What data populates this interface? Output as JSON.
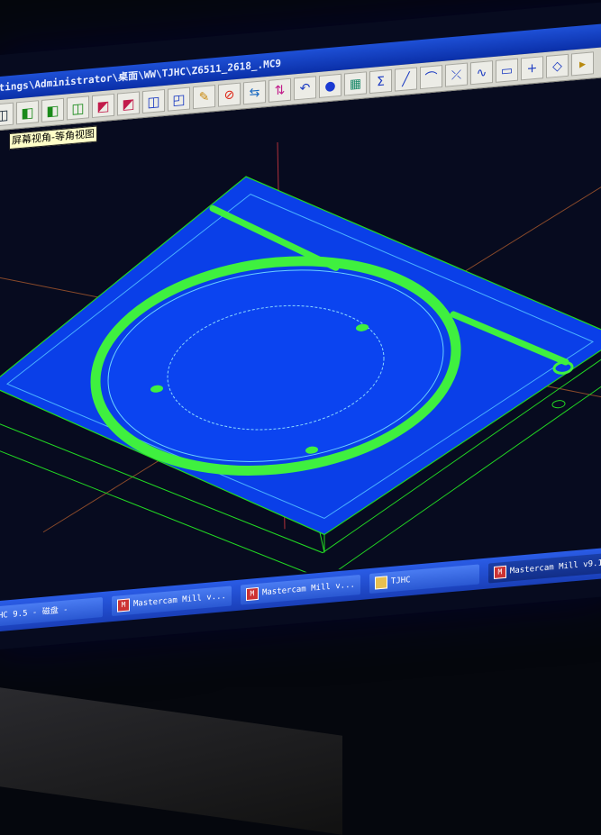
{
  "window": {
    "title": "ttings\\Administrator\\桌面\\WW\\TJHC\\Z6511_2618_.MC9"
  },
  "toolbar": {
    "icons": [
      "view-cube-icon",
      "view-cube-green-icon",
      "view-cube-green-2-icon",
      "view-cube-outline-icon",
      "view-cube-red-icon",
      "view-cube-red-2-icon",
      "view-cube-blue-icon",
      "view-3d-cube-icon",
      "pencil-icon",
      "no-entry-icon",
      "transform-arrow-icon",
      "transform-arrow-2-icon",
      "undo-arc-icon",
      "sphere-icon",
      "grid-snap-icon",
      "sigma-icon",
      "line-icon",
      "arc-icon",
      "trim-icon",
      "spline-icon",
      "rectangle-icon",
      "plus-point-icon",
      "eraser-icon",
      "toolbar-end-icon"
    ],
    "glyphs": [
      "◫",
      "◧",
      "◧",
      "◫",
      "◩",
      "◩",
      "◫",
      "◰",
      "✎",
      "⊘",
      "⇆",
      "⇅",
      "↶",
      "●",
      "▦",
      "Σ",
      "╱",
      "⌒",
      "⤫",
      "∿",
      "▭",
      "+",
      "◇",
      "▸"
    ]
  },
  "tooltip": {
    "text": "屏幕视角-等角视图"
  },
  "taskbar": {
    "items": [
      {
        "label": "HC 9.5 - 磁盘 -"
      },
      {
        "label": "Mastercam Mill v..."
      },
      {
        "label": "Mastercam Mill v..."
      },
      {
        "label": "TJHC"
      },
      {
        "label": "Mastercam Mill v9.1"
      }
    ]
  },
  "colors": {
    "part_face": "#0a3fe8",
    "toolpath_green": "#3ff03f",
    "wireframe": "#22d822",
    "axis_red": "#c0392b",
    "axis_orange": "#c86a2a"
  }
}
